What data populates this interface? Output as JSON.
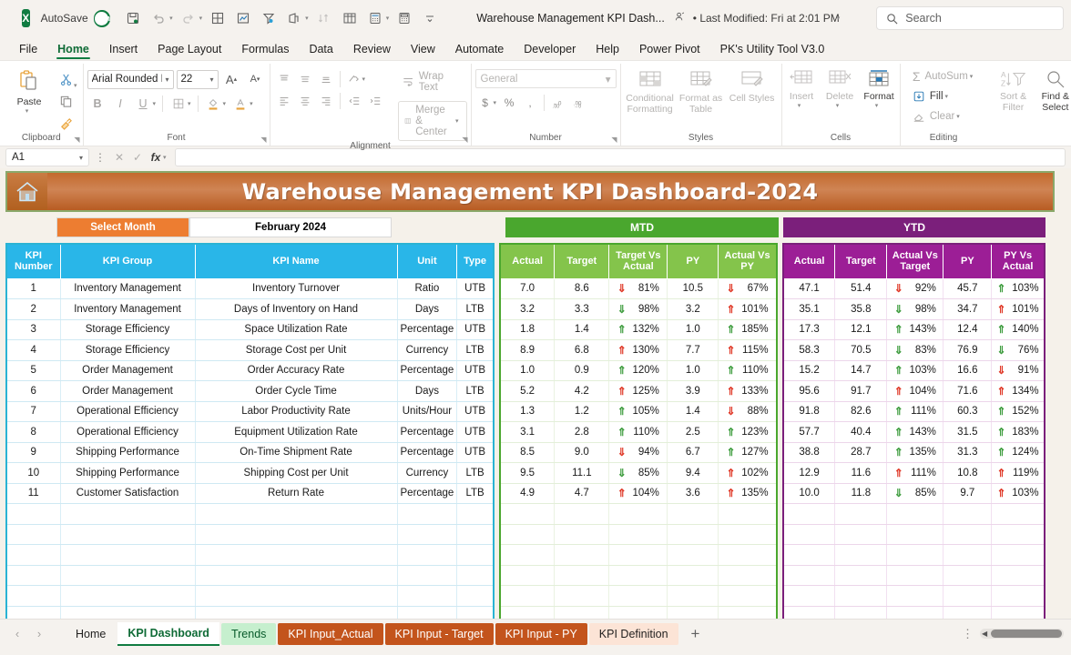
{
  "titlebar": {
    "app_icon": "excel-icon",
    "autosave_label": "AutoSave",
    "autosave_state": "On",
    "document_title": "Warehouse Management KPI Dash...",
    "last_modified": "• Last Modified: Fri at 2:01 PM",
    "search_placeholder": "Search",
    "quick_access": [
      {
        "name": "save-icon",
        "glyph": "save"
      },
      {
        "name": "undo-icon",
        "glyph": "undo"
      },
      {
        "name": "redo-icon",
        "glyph": "redo"
      },
      {
        "name": "borders-icon",
        "glyph": "grid"
      },
      {
        "name": "chart-icon",
        "glyph": "chart"
      },
      {
        "name": "filter-icon",
        "glyph": "funnel"
      },
      {
        "name": "share-icon",
        "glyph": "share"
      },
      {
        "name": "sort-icon",
        "glyph": "sort"
      },
      {
        "name": "table-icon",
        "glyph": "table"
      },
      {
        "name": "calculator-icon",
        "glyph": "calc"
      },
      {
        "name": "calculator2-icon",
        "glyph": "calc2"
      },
      {
        "name": "customize-qat-icon",
        "glyph": "chevron"
      }
    ]
  },
  "ribbon": {
    "tabs": [
      {
        "label": "File",
        "active": false
      },
      {
        "label": "Home",
        "active": true
      },
      {
        "label": "Insert",
        "active": false
      },
      {
        "label": "Page Layout",
        "active": false
      },
      {
        "label": "Formulas",
        "active": false
      },
      {
        "label": "Data",
        "active": false
      },
      {
        "label": "Review",
        "active": false
      },
      {
        "label": "View",
        "active": false
      },
      {
        "label": "Automate",
        "active": false
      },
      {
        "label": "Developer",
        "active": false
      },
      {
        "label": "Help",
        "active": false
      },
      {
        "label": "Power Pivot",
        "active": false
      },
      {
        "label": "PK's Utility Tool V3.0",
        "active": false
      }
    ],
    "groups": {
      "clipboard": {
        "label": "Clipboard",
        "paste_label": "Paste",
        "cut_icon": "scissors-icon",
        "copy_icon": "copy-icon",
        "format_painter_icon": "format-painter-icon"
      },
      "font": {
        "label": "Font",
        "font_name": "Arial Rounded MT",
        "font_size": "22",
        "grow_label": "A",
        "shrink_label": "A",
        "bold_label": "B",
        "italic_label": "I",
        "underline_label": "U"
      },
      "alignment": {
        "label": "Alignment",
        "wrap_text_label": "Wrap Text",
        "merge_center_label": "Merge & Center"
      },
      "number": {
        "label": "Number",
        "format_value": "General",
        "currency_label": "$",
        "percent_label": "%",
        "comma_label": ","
      },
      "styles": {
        "label": "Styles",
        "conditional_formatting_label": "Conditional Formatting",
        "format_as_table_label": "Format as Table",
        "cell_styles_label": "Cell Styles"
      },
      "cells": {
        "label": "Cells",
        "insert_label": "Insert",
        "delete_label": "Delete",
        "format_label": "Format"
      },
      "editing": {
        "label": "Editing",
        "autosum_label": "AutoSum",
        "fill_label": "Fill",
        "clear_label": "Clear",
        "sort_filter_label": "Sort & Filter",
        "find_select_label": "Find & Select"
      }
    }
  },
  "formula_bar": {
    "name_box": "A1",
    "formula_value": "",
    "cancel_icon": "close-icon",
    "enter_icon": "check-icon",
    "function_icon": "fx-icon"
  },
  "dashboard": {
    "title": "Warehouse Management KPI Dashboard-2024",
    "home_icon": "home-icon",
    "select_month_label": "Select Month",
    "select_month_value": "February 2024",
    "mtd_header": "MTD",
    "ytd_header": "YTD",
    "colors": {
      "banner": "#c36a2d",
      "select_month": "#ed7d31",
      "mtd": "#4aa72e",
      "ytd": "#7b1f7b",
      "info_header": "#29b6e8",
      "up_red": "#e03a29",
      "up_green": "#3f9d3f"
    }
  },
  "table": {
    "left_headers": [
      "KPI Number",
      "KPI Group",
      "KPI Name",
      "Unit",
      "Type"
    ],
    "mtd_headers": [
      "Actual",
      "Target",
      "Target Vs Actual",
      "PY",
      "Actual Vs PY"
    ],
    "ytd_headers": [
      "Actual",
      "Target",
      "Actual Vs Target",
      "PY",
      "PY Vs Actual"
    ],
    "rows": [
      {
        "num": "1",
        "group": "Inventory Management",
        "name": "Inventory Turnover",
        "unit": "Ratio",
        "type": "UTB",
        "mtd_actual": "7.0",
        "mtd_target": "8.6",
        "mtd_tva_dir": "down-red",
        "mtd_tva": "81%",
        "mtd_py": "10.5",
        "mtd_avp_dir": "down-red",
        "mtd_avp": "67%",
        "ytd_actual": "47.1",
        "ytd_target": "51.4",
        "ytd_avt_dir": "down-red",
        "ytd_avt": "92%",
        "ytd_py": "45.7",
        "ytd_pva_dir": "up-green",
        "ytd_pva": "103%"
      },
      {
        "num": "2",
        "group": "Inventory Management",
        "name": "Days of Inventory on Hand",
        "unit": "Days",
        "type": "LTB",
        "mtd_actual": "3.2",
        "mtd_target": "3.3",
        "mtd_tva_dir": "down-green",
        "mtd_tva": "98%",
        "mtd_py": "3.2",
        "mtd_avp_dir": "up-red",
        "mtd_avp": "101%",
        "ytd_actual": "35.1",
        "ytd_target": "35.8",
        "ytd_avt_dir": "down-green",
        "ytd_avt": "98%",
        "ytd_py": "34.7",
        "ytd_pva_dir": "up-red",
        "ytd_pva": "101%"
      },
      {
        "num": "3",
        "group": "Storage Efficiency",
        "name": "Space Utilization Rate",
        "unit": "Percentage",
        "type": "UTB",
        "mtd_actual": "1.8",
        "mtd_target": "1.4",
        "mtd_tva_dir": "up-green",
        "mtd_tva": "132%",
        "mtd_py": "1.0",
        "mtd_avp_dir": "up-green",
        "mtd_avp": "185%",
        "ytd_actual": "17.3",
        "ytd_target": "12.1",
        "ytd_avt_dir": "up-green",
        "ytd_avt": "143%",
        "ytd_py": "12.4",
        "ytd_pva_dir": "up-green",
        "ytd_pva": "140%"
      },
      {
        "num": "4",
        "group": "Storage Efficiency",
        "name": "Storage Cost per Unit",
        "unit": "Currency",
        "type": "LTB",
        "mtd_actual": "8.9",
        "mtd_target": "6.8",
        "mtd_tva_dir": "up-red",
        "mtd_tva": "130%",
        "mtd_py": "7.7",
        "mtd_avp_dir": "up-red",
        "mtd_avp": "115%",
        "ytd_actual": "58.3",
        "ytd_target": "70.5",
        "ytd_avt_dir": "down-green",
        "ytd_avt": "83%",
        "ytd_py": "76.9",
        "ytd_pva_dir": "down-green",
        "ytd_pva": "76%"
      },
      {
        "num": "5",
        "group": "Order Management",
        "name": "Order Accuracy Rate",
        "unit": "Percentage",
        "type": "UTB",
        "mtd_actual": "1.0",
        "mtd_target": "0.9",
        "mtd_tva_dir": "up-green",
        "mtd_tva": "120%",
        "mtd_py": "1.0",
        "mtd_avp_dir": "up-green",
        "mtd_avp": "110%",
        "ytd_actual": "15.2",
        "ytd_target": "14.7",
        "ytd_avt_dir": "up-green",
        "ytd_avt": "103%",
        "ytd_py": "16.6",
        "ytd_pva_dir": "down-red",
        "ytd_pva": "91%"
      },
      {
        "num": "6",
        "group": "Order Management",
        "name": "Order Cycle Time",
        "unit": "Days",
        "type": "LTB",
        "mtd_actual": "5.2",
        "mtd_target": "4.2",
        "mtd_tva_dir": "up-red",
        "mtd_tva": "125%",
        "mtd_py": "3.9",
        "mtd_avp_dir": "up-red",
        "mtd_avp": "133%",
        "ytd_actual": "95.6",
        "ytd_target": "91.7",
        "ytd_avt_dir": "up-red",
        "ytd_avt": "104%",
        "ytd_py": "71.6",
        "ytd_pva_dir": "up-red",
        "ytd_pva": "134%"
      },
      {
        "num": "7",
        "group": "Operational Efficiency",
        "name": "Labor Productivity Rate",
        "unit": "Units/Hour",
        "type": "UTB",
        "mtd_actual": "1.3",
        "mtd_target": "1.2",
        "mtd_tva_dir": "up-green",
        "mtd_tva": "105%",
        "mtd_py": "1.4",
        "mtd_avp_dir": "down-red",
        "mtd_avp": "88%",
        "ytd_actual": "91.8",
        "ytd_target": "82.6",
        "ytd_avt_dir": "up-green",
        "ytd_avt": "111%",
        "ytd_py": "60.3",
        "ytd_pva_dir": "up-green",
        "ytd_pva": "152%"
      },
      {
        "num": "8",
        "group": "Operational Efficiency",
        "name": "Equipment Utilization Rate",
        "unit": "Percentage",
        "type": "UTB",
        "mtd_actual": "3.1",
        "mtd_target": "2.8",
        "mtd_tva_dir": "up-green",
        "mtd_tva": "110%",
        "mtd_py": "2.5",
        "mtd_avp_dir": "up-green",
        "mtd_avp": "123%",
        "ytd_actual": "57.7",
        "ytd_target": "40.4",
        "ytd_avt_dir": "up-green",
        "ytd_avt": "143%",
        "ytd_py": "31.5",
        "ytd_pva_dir": "up-green",
        "ytd_pva": "183%"
      },
      {
        "num": "9",
        "group": "Shipping Performance",
        "name": "On-Time Shipment Rate",
        "unit": "Percentage",
        "type": "UTB",
        "mtd_actual": "8.5",
        "mtd_target": "9.0",
        "mtd_tva_dir": "down-red",
        "mtd_tva": "94%",
        "mtd_py": "6.7",
        "mtd_avp_dir": "up-green",
        "mtd_avp": "127%",
        "ytd_actual": "38.8",
        "ytd_target": "28.7",
        "ytd_avt_dir": "up-green",
        "ytd_avt": "135%",
        "ytd_py": "31.3",
        "ytd_pva_dir": "up-green",
        "ytd_pva": "124%"
      },
      {
        "num": "10",
        "group": "Shipping Performance",
        "name": "Shipping Cost per Unit",
        "unit": "Currency",
        "type": "LTB",
        "mtd_actual": "9.5",
        "mtd_target": "11.1",
        "mtd_tva_dir": "down-green",
        "mtd_tva": "85%",
        "mtd_py": "9.4",
        "mtd_avp_dir": "up-red",
        "mtd_avp": "102%",
        "ytd_actual": "12.9",
        "ytd_target": "11.6",
        "ytd_avt_dir": "up-red",
        "ytd_avt": "111%",
        "ytd_py": "10.8",
        "ytd_pva_dir": "up-red",
        "ytd_pva": "119%"
      },
      {
        "num": "11",
        "group": "Customer Satisfaction",
        "name": "Return Rate",
        "unit": "Percentage",
        "type": "LTB",
        "mtd_actual": "4.9",
        "mtd_target": "4.7",
        "mtd_tva_dir": "up-red",
        "mtd_tva": "104%",
        "mtd_py": "3.6",
        "mtd_avp_dir": "up-red",
        "mtd_avp": "135%",
        "ytd_actual": "10.0",
        "ytd_target": "11.8",
        "ytd_avt_dir": "down-green",
        "ytd_avt": "85%",
        "ytd_py": "9.7",
        "ytd_pva_dir": "up-red",
        "ytd_pva": "103%"
      }
    ]
  },
  "sheet_tabs": {
    "prev_icon": "chevron-left-icon",
    "next_icon": "chevron-right-icon",
    "add_label": "+",
    "tabs": [
      {
        "label": "Home",
        "active": false,
        "bg": "",
        "fg": ""
      },
      {
        "label": "KPI Dashboard",
        "active": true,
        "bg": "",
        "fg": ""
      },
      {
        "label": "Trends",
        "active": false,
        "bg": "#c6efce",
        "fg": "#0a5c2c"
      },
      {
        "label": "KPI Input_Actual",
        "active": false,
        "bg": "#c3541c",
        "fg": "#ffffff"
      },
      {
        "label": "KPI Input - Target",
        "active": false,
        "bg": "#c3541c",
        "fg": "#ffffff"
      },
      {
        "label": "KPI Input - PY",
        "active": false,
        "bg": "#c3541c",
        "fg": "#ffffff"
      },
      {
        "label": "KPI Definition",
        "active": false,
        "bg": "#fce4d6",
        "fg": "#201f1e"
      }
    ]
  }
}
